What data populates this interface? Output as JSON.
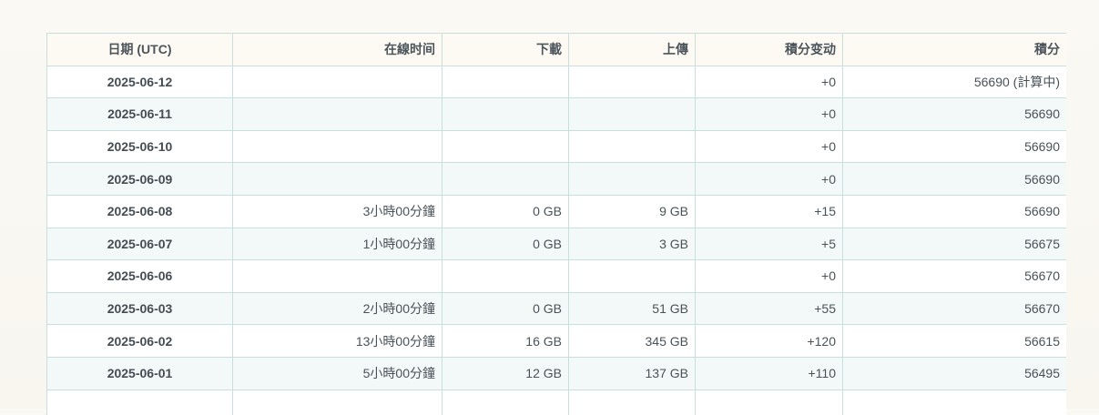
{
  "columns": {
    "date": "日期 (UTC)",
    "online": "在線时间",
    "download": "下載",
    "upload": "上傳",
    "delta": "積分变动",
    "points": "積分"
  },
  "rows": [
    {
      "date": "2025-06-12",
      "online": "",
      "download": "",
      "upload": "",
      "delta": "+0",
      "points": "56690 (計算中)"
    },
    {
      "date": "2025-06-11",
      "online": "",
      "download": "",
      "upload": "",
      "delta": "+0",
      "points": "56690"
    },
    {
      "date": "2025-06-10",
      "online": "",
      "download": "",
      "upload": "",
      "delta": "+0",
      "points": "56690"
    },
    {
      "date": "2025-06-09",
      "online": "",
      "download": "",
      "upload": "",
      "delta": "+0",
      "points": "56690"
    },
    {
      "date": "2025-06-08",
      "online": "3小時00分鐘",
      "download": "0 GB",
      "upload": "9 GB",
      "delta": "+15",
      "points": "56690"
    },
    {
      "date": "2025-06-07",
      "online": "1小時00分鐘",
      "download": "0 GB",
      "upload": "3 GB",
      "delta": "+5",
      "points": "56675"
    },
    {
      "date": "2025-06-06",
      "online": "",
      "download": "",
      "upload": "",
      "delta": "+0",
      "points": "56670"
    },
    {
      "date": "2025-06-03",
      "online": "2小時00分鐘",
      "download": "0 GB",
      "upload": "51 GB",
      "delta": "+55",
      "points": "56670"
    },
    {
      "date": "2025-06-02",
      "online": "13小時00分鐘",
      "download": "16 GB",
      "upload": "345 GB",
      "delta": "+120",
      "points": "56615"
    },
    {
      "date": "2025-06-01",
      "online": "5小時00分鐘",
      "download": "12 GB",
      "upload": "137 GB",
      "delta": "+110",
      "points": "56495"
    },
    {
      "date": "",
      "online": "",
      "download": "",
      "upload": "",
      "delta": "",
      "points": ""
    }
  ]
}
